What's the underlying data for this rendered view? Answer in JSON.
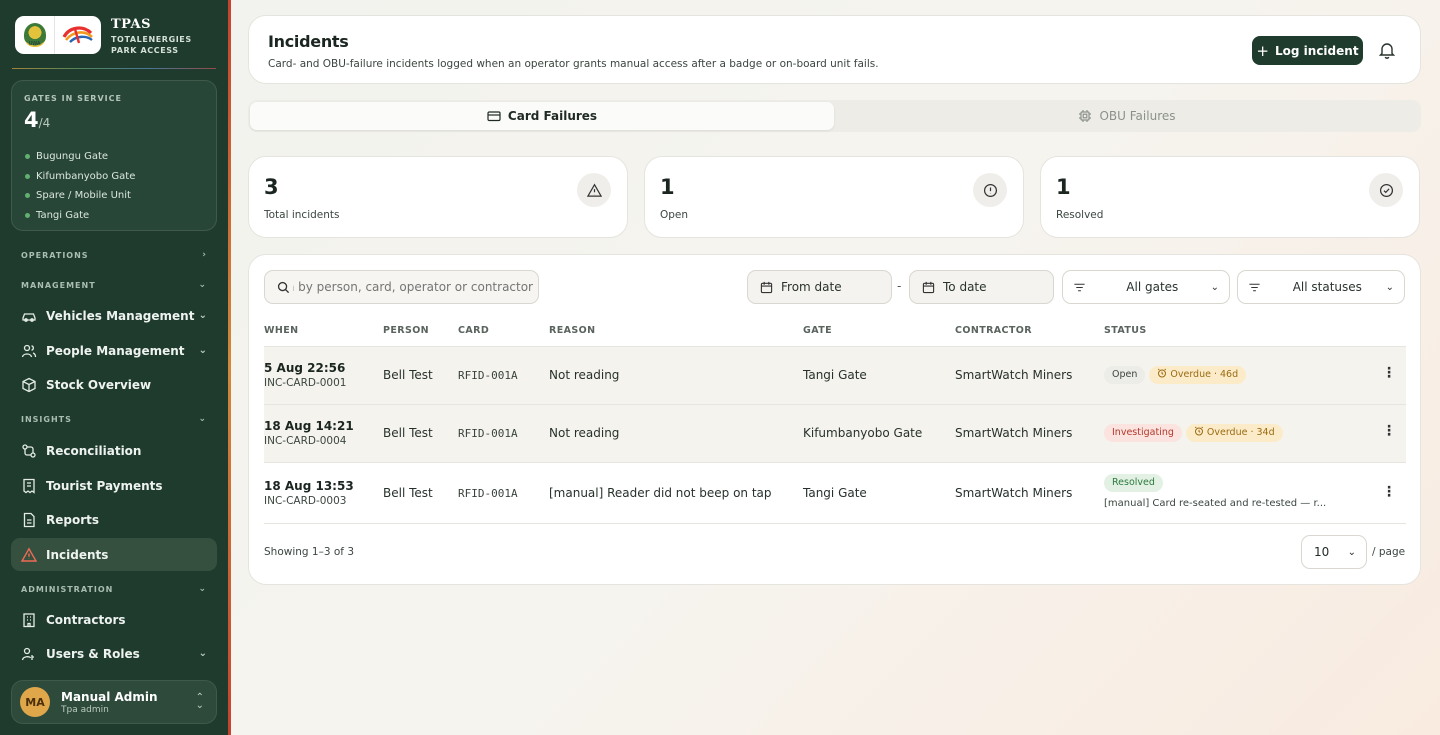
{
  "brand": {
    "name": "TPAS",
    "subtitle": "TOTALENERGIES PARK ACCESS",
    "uwa_text": "UWA"
  },
  "gates": {
    "caption": "GATES IN SERVICE",
    "count": "4",
    "total": "/4",
    "items": [
      "Bugungu Gate",
      "Kifumbanyobo Gate",
      "Spare / Mobile Unit",
      "Tangi Gate"
    ]
  },
  "sidebar": {
    "sections": {
      "operations": "OPERATIONS",
      "management": "MANAGEMENT",
      "insights": "INSIGHTS",
      "administration": "ADMINISTRATION"
    },
    "items": {
      "vehicles": "Vehicles Management",
      "people": "People Management",
      "stock": "Stock Overview",
      "reconciliation": "Reconciliation",
      "tourist": "Tourist Payments",
      "reports": "Reports",
      "incidents": "Incidents",
      "contractors": "Contractors",
      "users": "Users & Roles"
    }
  },
  "user": {
    "initials": "MA",
    "name": "Manual Admin",
    "role": "Tpa admin"
  },
  "header": {
    "title": "Incidents",
    "subtitle": "Card- and OBU-failure incidents logged when an operator grants manual access after a badge or on-board unit fails.",
    "log_button": "Log incident"
  },
  "tabs": {
    "card": "Card Failures",
    "obu": "OBU Failures"
  },
  "stats": {
    "total": {
      "value": "3",
      "label": "Total incidents"
    },
    "open": {
      "value": "1",
      "label": "Open"
    },
    "resolved": {
      "value": "1",
      "label": "Resolved"
    }
  },
  "filters": {
    "search_placeholder": "Search by person, card, operator or contractor...",
    "from": "From date",
    "to": "To date",
    "dash": "-",
    "gates": "All gates",
    "statuses": "All statuses"
  },
  "table": {
    "headers": {
      "when": "WHEN",
      "person": "PERSON",
      "card": "CARD",
      "reason": "REASON",
      "gate": "GATE",
      "contractor": "CONTRACTOR",
      "status": "STATUS"
    },
    "rows": [
      {
        "when": "5 Aug 22:56",
        "id": "INC-CARD-0001",
        "person": "Bell Test",
        "card": "RFID-001A",
        "reason": "Not reading",
        "gate": "Tangi Gate",
        "contractor": "SmartWatch Miners",
        "status": "Open",
        "overdue": "Overdue · 46d"
      },
      {
        "when": "18 Aug 14:21",
        "id": "INC-CARD-0004",
        "person": "Bell Test",
        "card": "RFID-001A",
        "reason": "Not reading",
        "gate": "Kifumbanyobo Gate",
        "contractor": "SmartWatch Miners",
        "status": "Investigating",
        "overdue": "Overdue · 34d"
      },
      {
        "when": "18 Aug 13:53",
        "id": "INC-CARD-0003",
        "person": "Bell Test",
        "card": "RFID-001A",
        "reason": "[manual] Reader did not beep on tap",
        "gate": "Tangi Gate",
        "contractor": "SmartWatch Miners",
        "status": "Resolved",
        "note": "[manual] Card re-seated and re-tested — r..."
      }
    ]
  },
  "footer": {
    "showing": "Showing 1–3 of 3",
    "page_size": "10",
    "per_page": "/ page"
  },
  "colors": {
    "sidebar": "#1f3b2d",
    "accent_orange": "#e0a64a",
    "open_green": "#62b06f",
    "investigating": "#b23a2a"
  }
}
